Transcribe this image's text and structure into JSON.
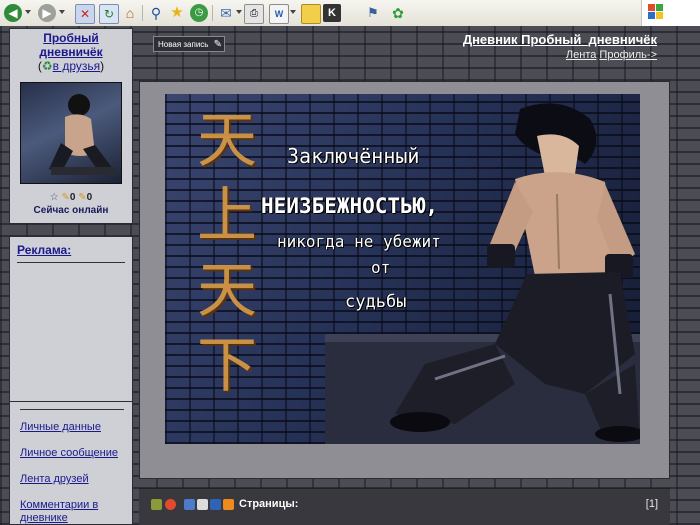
{
  "diary": {
    "name": "Пробный дневничёк",
    "add_friend": "в друзья",
    "status_count_1": "0",
    "status_count_2": "0",
    "online": "Сейчас онлайн",
    "title": "Дневник Пробный_дневничёк",
    "feed": "Лента",
    "profile": "Профиль->"
  },
  "sidebar": {
    "ad_title": "Реклама:",
    "links": [
      "Личные данные",
      "Личное сообщение",
      "Лента друзей",
      "Комментарии в дневнике"
    ]
  },
  "post": {
    "new_post_button": "Новая запись",
    "quote_lines": [
      "Заключённый",
      "НЕИЗБЕЖНОСТЬЮ,",
      "никогда не убежит",
      "от",
      "судьбы"
    ],
    "hanzi": [
      "天",
      "上",
      "天",
      "下"
    ]
  },
  "footer": {
    "pages_label": "Страницы:",
    "page_number": "[1]"
  },
  "colors": {
    "panel": "#cfcfd6",
    "link": "#1a1a8c",
    "footer": "#38383e",
    "hanzi": "#d79a45"
  }
}
